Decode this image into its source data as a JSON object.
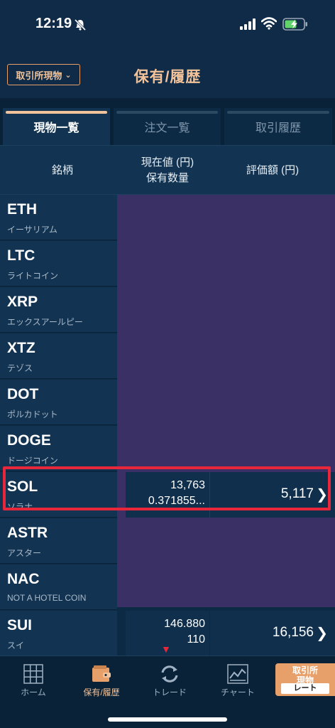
{
  "status": {
    "time": "12:19"
  },
  "header": {
    "exchange_select": "取引所現物",
    "title": "保有/履歴"
  },
  "tabs": [
    {
      "label": "現物一覧"
    },
    {
      "label": "注文一覧"
    },
    {
      "label": "取引履歴"
    }
  ],
  "columns": {
    "name": "銘柄",
    "price_line1": "現在値 (円)",
    "price_line2": "保有数量",
    "amount": "評価額 (円)"
  },
  "rows": [
    {
      "symbol": "ETH",
      "jp": "イーサリアム"
    },
    {
      "symbol": "LTC",
      "jp": "ライトコイン"
    },
    {
      "symbol": "XRP",
      "jp": "エックスアールピー"
    },
    {
      "symbol": "XTZ",
      "jp": "テゾス"
    },
    {
      "symbol": "DOT",
      "jp": "ポルカドット"
    },
    {
      "symbol": "DOGE",
      "jp": "ドージコイン"
    },
    {
      "symbol": "SOL",
      "jp": "ソラナ",
      "price": "13,763",
      "qty": "0.371855...",
      "amount": "5,117"
    },
    {
      "symbol": "ASTR",
      "jp": "アスター"
    },
    {
      "symbol": "NAC",
      "jp": "NOT A HOTEL COIN"
    },
    {
      "symbol": "SUI",
      "jp": "スイ",
      "price": "146.880",
      "qty": "110",
      "amount": "16,156"
    }
  ],
  "tabbar": {
    "home": "ホーム",
    "holdings": "保有/履歴",
    "trade": "トレード",
    "chart": "チャート",
    "rate_top": "取引所\n現物",
    "rate_top_1": "取引所",
    "rate_top_2": "現物",
    "rate_bottom": "レート"
  },
  "colors": {
    "accent": "#f2c39a",
    "highlight": "#e8283a",
    "purple": "#3a3065"
  }
}
